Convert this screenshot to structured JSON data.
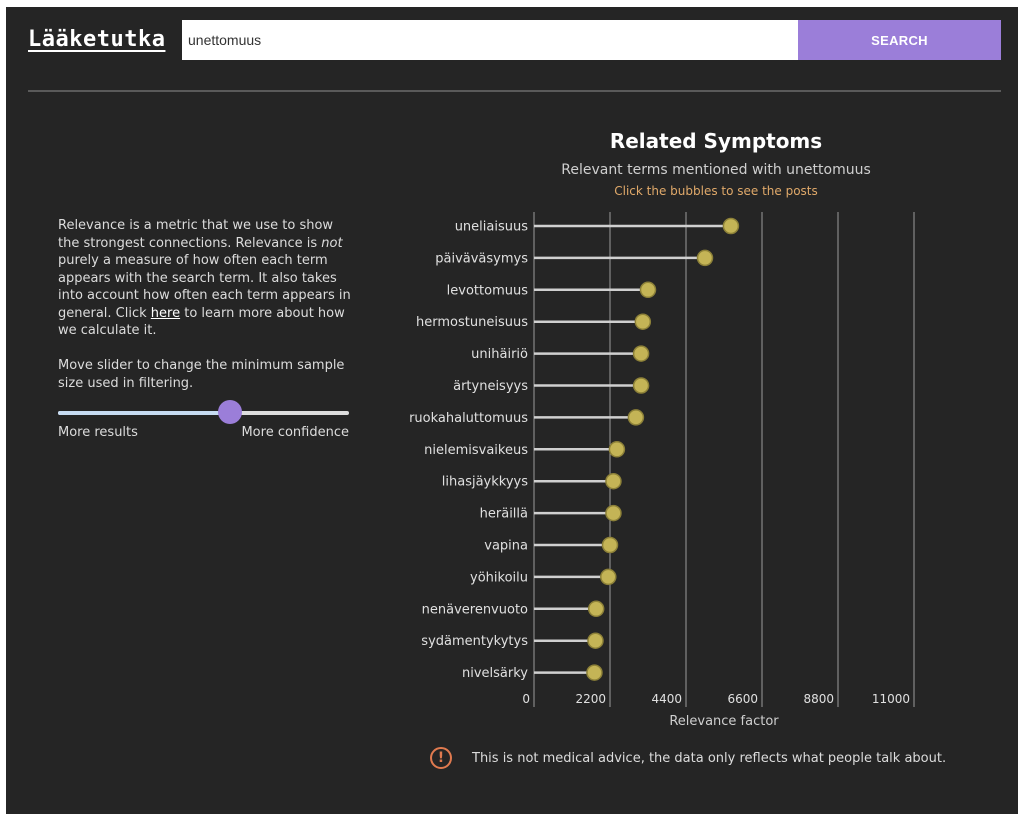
{
  "app": {
    "title": "Lääketutka"
  },
  "search": {
    "value": "unettomuus",
    "button_label": "SEARCH"
  },
  "info": {
    "text_1": "Relevance is a metric that we use to show the strongest connections. Relevance is ",
    "text_not": "not",
    "text_2": " purely a measure of how often each term appears with the search term. It also takes into account how often each term appears in general. Click ",
    "link": "here",
    "text_3": " to learn more about how we calculate it."
  },
  "slider": {
    "description": "Move slider to change the minimum sample size used in filtering.",
    "min_label": "More results",
    "max_label": "More confidence",
    "value": 0.59
  },
  "chart_data": {
    "type": "lollipop",
    "title": "Related Symptoms",
    "subtitle": "Relevant terms mentioned with unettomuus",
    "hint": "Click the bubbles to see the posts",
    "xlabel": "Relevance factor",
    "xlim": [
      0,
      11000
    ],
    "xticks": [
      0,
      2200,
      4400,
      6600,
      8800,
      11000
    ],
    "grid": true,
    "colors": {
      "stem": "#d0d0d0",
      "bubble": "#c4b456",
      "bubble_edge": "#8d8138",
      "grid": "#9a9a9a"
    },
    "categories": [
      "uneliaisuus",
      "päiväväsymys",
      "levottomuus",
      "hermostuneisuus",
      "unihäiriö",
      "ärtyneisyys",
      "ruokahaluttomuus",
      "nielemisvaikeus",
      "lihasjäykkyys",
      "heräillä",
      "vapina",
      "yöhikoilu",
      "nenäverenvuoto",
      "sydämentykytys",
      "nivelsärky"
    ],
    "values": [
      5700,
      4950,
      3300,
      3150,
      3100,
      3100,
      2950,
      2400,
      2300,
      2300,
      2200,
      2150,
      1800,
      1780,
      1750
    ]
  },
  "disclaimer": {
    "icon": "warning-icon",
    "text": "This is not medical advice, the data only reflects what people talk about."
  }
}
